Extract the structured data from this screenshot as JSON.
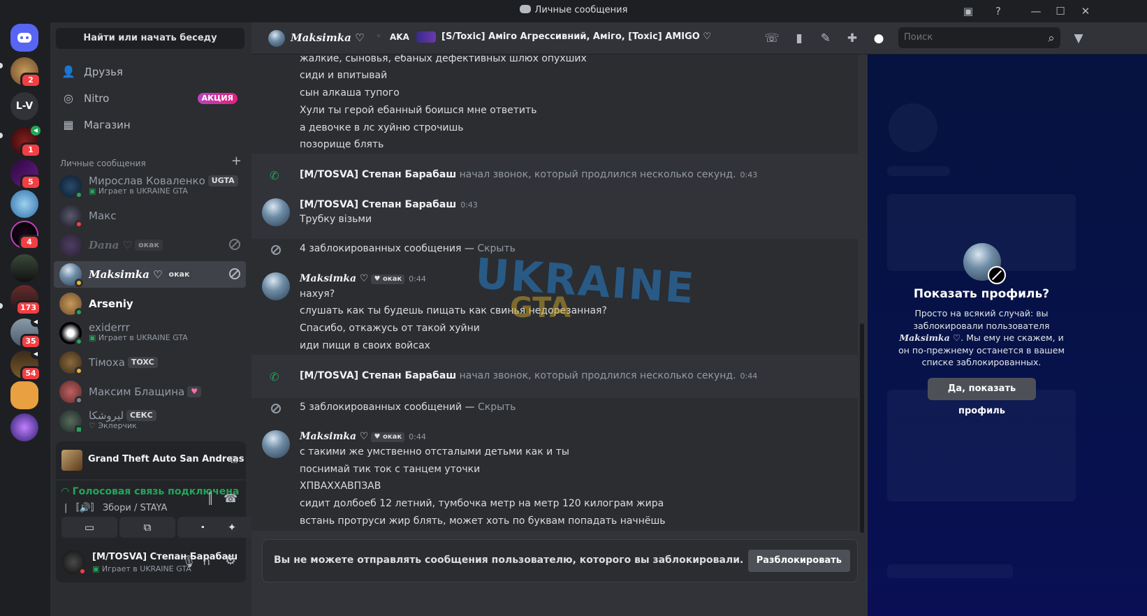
{
  "window": {
    "title": "Личные сообщения"
  },
  "rail": {
    "home_label": "Home",
    "servers": [
      {
        "text": "",
        "badge": "2"
      },
      {
        "text": "L-V",
        "badge": ""
      },
      {
        "text": "",
        "badge": "1"
      },
      {
        "text": "",
        "badge": "5"
      },
      {
        "text": "",
        "badge": ""
      },
      {
        "text": "",
        "badge": "4"
      },
      {
        "text": "",
        "badge": ""
      },
      {
        "text": "",
        "badge": "173"
      },
      {
        "text": "",
        "badge": "35"
      },
      {
        "text": "",
        "badge": "54"
      },
      {
        "text": "",
        "badge": ""
      },
      {
        "text": "",
        "badge": ""
      }
    ]
  },
  "sidebar": {
    "search_label": "Найти или начать беседу",
    "nav": [
      {
        "label": "Друзья"
      },
      {
        "label": "Nitro",
        "promo": "АКЦИЯ"
      },
      {
        "label": "Магазин"
      }
    ],
    "dm_header": "Личные сообщения",
    "dms": [
      {
        "name": "Мирослав Коваленко",
        "tag": "UGTA",
        "sub": "Играет в UKRAINE GTA"
      },
      {
        "name": "Макс"
      },
      {
        "name": "Dana ♡",
        "tag": "окак"
      },
      {
        "name": "Maksimka ♡",
        "tag": "окак"
      },
      {
        "name": "Arseniy"
      },
      {
        "name": "exiderrr",
        "sub": "Играет в UKRAINE GTA"
      },
      {
        "name": "Тімоха",
        "tag": "TOXC"
      },
      {
        "name": "Максим Блащина"
      },
      {
        "name": "ليروشكا",
        "tag": "СЕКС",
        "sub": "♡ Эклерчик"
      }
    ],
    "game_activity": "Grand Theft Auto San Andreas",
    "voice": {
      "status": "Голосовая связь подключена",
      "channel": "| 〚🔊〛 Збори / STAYA"
    },
    "user": {
      "name": "[M/TOSVA] Степан Барабаш",
      "status": "Играет в UKRAINE GTA"
    }
  },
  "header": {
    "name": "Maksimka ♡",
    "aka": "AKA",
    "aka_names": "[S/Toxic] Аміго Агрессивний, Аміго, [Toxic] AMIGO ♡",
    "search_placeholder": "Поиск"
  },
  "chat": {
    "block1": [
      "жалкие, сыновья, ебаных дефективных шлюх опухших",
      "сиди и впитывай",
      "сын алкаша тупого",
      "Хули ты герой ебанный боишся мне ответить",
      "а девочке в лс хуйню строчишь",
      "позорище блять"
    ],
    "call1": {
      "user": "[M/TOSVA] Степан Барабаш",
      "text": "начал звонок, который продлился несколько секунд.",
      "time": "0:43"
    },
    "msg1": {
      "user": "[M/TOSVA] Степан Барабаш",
      "time": "0:43",
      "lines": [
        "Трубку візьми"
      ]
    },
    "blocked1": {
      "text": "4 заблокированных сообщения —",
      "action": "Скрыть"
    },
    "msg2": {
      "user": "Maksimka ♡",
      "tag": "окак",
      "time": "0:44",
      "lines": [
        "нахуя?",
        "слушать как ты будешь пищать как свинья недорезанная?",
        "Спасибо, откажусь от такой хуйни",
        "иди пищи в своих войсах"
      ]
    },
    "call2": {
      "user": "[M/TOSVA] Степан Барабаш",
      "text": "начал звонок, который продлился несколько секунд.",
      "time": "0:44"
    },
    "blocked2": {
      "text": "5 заблокированных сообщений —",
      "action": "Скрыть"
    },
    "msg3": {
      "user": "Maksimka ♡",
      "tag": "окак",
      "time": "0:44",
      "lines": [
        "с такими же умственно отсталыми детьми как и ты",
        "поснимай тик ток с танцем уточки",
        "ХПВАХХАВПЗАВ",
        "сидит долбоеб 12 летний, тумбочка метр на метр 120 килограм жира",
        "встань протруси жир блять, может хоть по буквам попадать начнёшь"
      ]
    },
    "watermark": "UKRAINE",
    "watermark2": "GTA",
    "composer_text": "Вы не можете отправлять сообщения пользователю, которого вы заблокировали.",
    "unblock_label": "Разблокировать"
  },
  "profile": {
    "title": "Показать профиль?",
    "desc_pre": "Просто на всякий случай: вы заблокировали пользователя",
    "desc_name": "Maksimka ♡",
    "desc_post": ". Мы ему не скажем, и он по-прежнему останется в вашем списке заблокированных.",
    "button": "Да, показать профиль"
  },
  "colors": {
    "accent": "#5865f2",
    "green": "#23a55a",
    "red": "#f23f43",
    "promo": "#e41f7b"
  }
}
